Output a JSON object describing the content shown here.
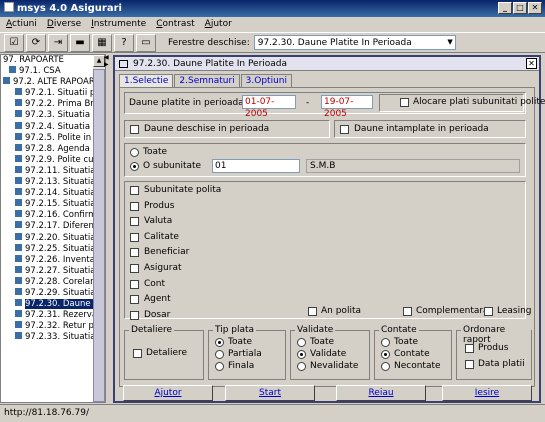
{
  "window": {
    "title": "msys 4.0 Asigurari",
    "controls": [
      "_",
      "□",
      "✕"
    ]
  },
  "menu": [
    "Actiuni",
    "Diverse",
    "Instrumente",
    "Contrast",
    "Ajutor"
  ],
  "toolbar": {
    "windows_label": "Ferestre deschise:",
    "windows_value": "97.2.30. Daune Platite In Perioada",
    "icons": [
      "checklist-icon",
      "refresh-icon",
      "exit-door-icon",
      "card-icon",
      "calendar-icon",
      "help-icon",
      "window-icon"
    ]
  },
  "tree": {
    "items": [
      {
        "label": "97. RAPOARTE",
        "indent": 0,
        "icon": false
      },
      {
        "label": "97.1. CSA",
        "indent": 1,
        "icon": true
      },
      {
        "label": "97.2. ALTE RAPOARTE",
        "indent": 0,
        "icon": true
      },
      {
        "label": "97.2.1. Situatii po",
        "indent": 2,
        "icon": true
      },
      {
        "label": "97.2.2. Prima Bru",
        "indent": 2,
        "icon": true
      },
      {
        "label": "97.2.3. Situatia po",
        "indent": 2,
        "icon": true
      },
      {
        "label": "97.2.4. Situatia po",
        "indent": 2,
        "icon": true
      },
      {
        "label": "97.2.5. Polite in c",
        "indent": 2,
        "icon": true
      },
      {
        "label": "97.2.8. Agenda ac",
        "indent": 2,
        "icon": true
      },
      {
        "label": "97.2.9. Polite cu r",
        "indent": 2,
        "icon": true
      },
      {
        "label": "97.2.11. Situatia",
        "indent": 2,
        "icon": true
      },
      {
        "label": "97.2.13. Situatia",
        "indent": 2,
        "icon": true
      },
      {
        "label": "97.2.14. Situatia",
        "indent": 2,
        "icon": true
      },
      {
        "label": "97.2.15. Situatia",
        "indent": 2,
        "icon": true
      },
      {
        "label": "97.2.16. Confirma",
        "indent": 2,
        "icon": true
      },
      {
        "label": "97.2.17. Diferent",
        "indent": 2,
        "icon": true
      },
      {
        "label": "97.2.20. Situatia",
        "indent": 2,
        "icon": true
      },
      {
        "label": "97.2.25. Situatia",
        "indent": 2,
        "icon": true
      },
      {
        "label": "97.2.26. Inventar",
        "indent": 2,
        "icon": true
      },
      {
        "label": "97.2.27. Situatia",
        "indent": 2,
        "icon": true
      },
      {
        "label": "97.2.28. Corelare",
        "indent": 2,
        "icon": true
      },
      {
        "label": "97.2.29. Situatia",
        "indent": 2,
        "icon": true
      },
      {
        "label": "97.2.30. Daune P",
        "indent": 2,
        "icon": true,
        "selected": true
      },
      {
        "label": "97.2.31. Rezerva",
        "indent": 2,
        "icon": true
      },
      {
        "label": "97.2.32. Retur pri",
        "indent": 2,
        "icon": true
      },
      {
        "label": "97.2.33. Situatia",
        "indent": 2,
        "icon": true
      }
    ]
  },
  "status_url": "http://81.18.76.79/",
  "dialog": {
    "title": "97.2.30. Daune Platite In Perioada",
    "tabs": [
      "1.Selectie",
      "2.Semnaturi",
      "3.Optiuni"
    ],
    "period_label": "Daune platite in perioada:",
    "date_from": "01-07-2005",
    "date_sep": "-",
    "date_to": "19-07-2005",
    "alocare_label": "Alocare plati subunitati politei",
    "daune_deschise_label": "Daune deschise in perioada",
    "daune_intamplate_label": "Daune intamplate in perioada",
    "toate_label": "Toate",
    "o_subunitate_label": "O subunitate",
    "subunitate_code": "01",
    "subunitate_name": "S.M.B",
    "filters": [
      "Subunitate polita",
      "Produs",
      "Valuta",
      "Calitate",
      "Beneficiar",
      "Asigurat",
      "Cont",
      "Agent",
      "Dosar"
    ],
    "an_polita_label": "An polita",
    "complementara_label": "Complementara",
    "leasing_label": "Leasing",
    "detaliere": {
      "title": "Detaliere",
      "option": "Detaliere"
    },
    "tip_plata": {
      "title": "Tip plata",
      "options": [
        "Toate",
        "Partiala",
        "Finala"
      ],
      "selected": 0
    },
    "validate": {
      "title": "Validate",
      "options": [
        "Toate",
        "Validate",
        "Nevalidate"
      ],
      "selected": 1
    },
    "contate": {
      "title": "Contate",
      "options": [
        "Toate",
        "Contate",
        "Necontate"
      ],
      "selected": 1
    },
    "ordonare": {
      "title": "Ordonare raport",
      "options": [
        "Produs",
        "Data platii"
      ]
    },
    "buttons": [
      "Ajutor",
      "Start",
      "Reiau",
      "Iesire"
    ]
  }
}
